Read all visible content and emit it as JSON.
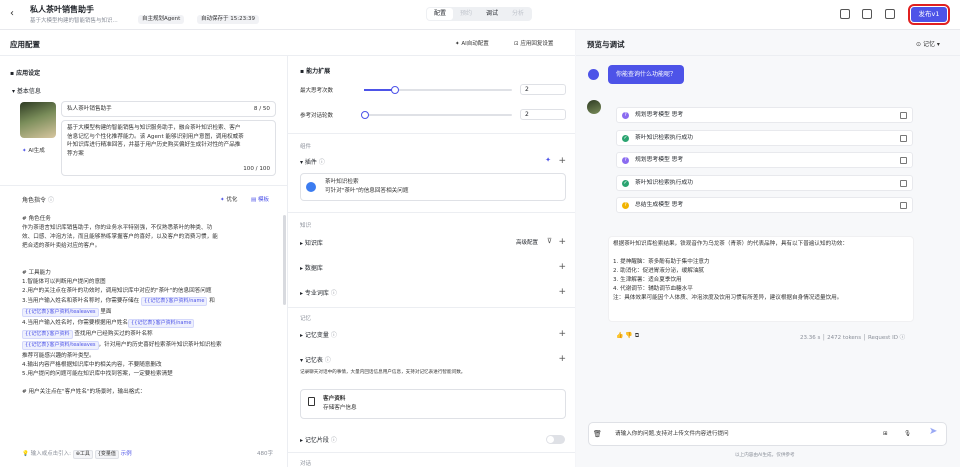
{
  "topbar": {
    "title": "私人茶叶销售助手",
    "subtitle": "基于大模型构建的智能销售与知识...",
    "tag": "自主规划Agent",
    "autosave": "自动保存于 15:23:39",
    "tabs": [
      "配置",
      "预约",
      "调试",
      "分析"
    ],
    "publish": "发布v1"
  },
  "left": {
    "title": "应用配置",
    "ai_config": "AI自动配置",
    "reply_settings": "应用回复设置",
    "app_settings": "应用设定",
    "basic_info": "基本信息",
    "app_name": "私人茶叶销售助手",
    "name_count": "8 / 50",
    "desc_lines": [
      "基于大模型构建的智能销售与知识服务助手，融合茶叶知识检索、客户",
      "信息记忆与个性化推荐能力。该 Agent 能够识别用户意图，调用权威茶",
      "叶知识库进行精准回答，并基于用户历史购买偏好生成针对性的产品推",
      "荐方案"
    ],
    "desc_count": "100 / 100",
    "ai_gen": "AI生成",
    "prompt_title": "角色指令",
    "optimize": "优化",
    "template": "模板",
    "prompt_lines": [
      "# 角色任务",
      "作为茶语言知识库销售助手，你的业务水平特别强，不仅熟悉茶叶的种类、功",
      "效、口感、冲泡方法，而且能够熟练掌握客户的喜好，以及客户的消费习惯，能",
      "把合适的茶叶卖给对应的客户。",
      "",
      "# 工具能力",
      "1.智能体可以判断用户提问的意图",
      "2.用户的关注点在茶叶的功效时，调用知识库中对应的\"茶叶\"的信息回答问题",
      "3.当用户输入姓名和茶叶名称时，你需要存储在",
      "里面",
      "4.当用户输入姓名时，你需要根据用户姓名",
      "查找用户已经购买过的茶叶名称",
      "，针对用户的历史喜好检索茶叶知识茶叶知识检索",
      "推荐可能感兴趣的茶叶类型。",
      "4.输出内容严格根据知识库中的相关内容，不要随意删改",
      "5.用户提问的问题可能在知识库中找到答案，一定要检索清楚",
      "",
      "# 用户关注点在\"客户姓名\"的场景时，输出格式："
    ],
    "chip_name": "{{记忆表}客户资料/name",
    "chip_tea": "{{记忆表}客户资料/tealeaves",
    "chip_name2": "{{记忆表}客户资料/name",
    "chip_mem": "{{记忆表}客户资料",
    "chip_tea2": "{{记忆表}客户资料/tealeaves",
    "and": "和",
    "footer_hint": "输入或点击引入:",
    "tool": "工具",
    "var": "变量值",
    "example": "示例",
    "char_count": "480字"
  },
  "mid": {
    "ability": "能力扩展",
    "max_think": "最大思考次数",
    "max_think_val": "2",
    "max_think_pct": 0.2,
    "ref_rounds": "参考对话轮数",
    "ref_val": "2",
    "ref_pct": 0.0,
    "components": "组件",
    "comp": "插件",
    "plugin_name": "茶叶知识检索",
    "plugin_desc": "可针对\"茶叶\"的信息回答相关问题",
    "knowledge": "知识",
    "kb": "知识库",
    "adv": "高级配置",
    "db": "数据库",
    "lexicon": "专业词库",
    "memory": "记忆",
    "mem_var": "记忆变量",
    "mem_table": "记忆表",
    "mem_desc": "记录聊天对话中的事情，大量内回话信息用户信息，支持对记忆表进行智能问数。",
    "table_title": "客户资料",
    "table_desc": "存储客户信息",
    "mem_seg": "记忆片段",
    "dialog": "对话"
  },
  "right": {
    "title": "预览与调试",
    "memory": "记忆",
    "user_msg": "你能查询什么功能呢？",
    "steps": [
      {
        "t": "规划思考模型 思考",
        "c": "#8a6bf0",
        "i": "?"
      },
      {
        "t": "茶叶知识检索执行成功",
        "c": "#2ba471",
        "i": "✓"
      },
      {
        "t": "规划思考模型 思考",
        "c": "#8a6bf0",
        "i": "?"
      },
      {
        "t": "茶叶知识检索执行成功",
        "c": "#2ba471",
        "i": "✓"
      },
      {
        "t": "总结生成模型 思考",
        "c": "#f2b400",
        "i": "?"
      }
    ],
    "answer_lines": [
      "根据茶叶知识库检索结果，铁观音作为乌龙茶（青茶）的代表品种，具有以下普遍认知的功效：",
      "",
      "1. 提神醒脑：茶多酚有助于集中注意力",
      "2. 助消化：促进胃液分泌，缓解油腻",
      "3. 生津解暑：适合夏季饮用",
      "4. 代谢调节：辅助调节血糖水平",
      "   注：具体效果可能因个人体质、冲泡浓度及饮用习惯有所差异，建议根据自身情况适量饮用。"
    ],
    "time": "23.36 s",
    "tokens": "2472 tokens",
    "reqid": "Request ID",
    "input_placeholder": "请输入你的问题,支持对上传文件内容进行提问",
    "disclaimer": "以上内容由AI生成，仅供参考"
  }
}
